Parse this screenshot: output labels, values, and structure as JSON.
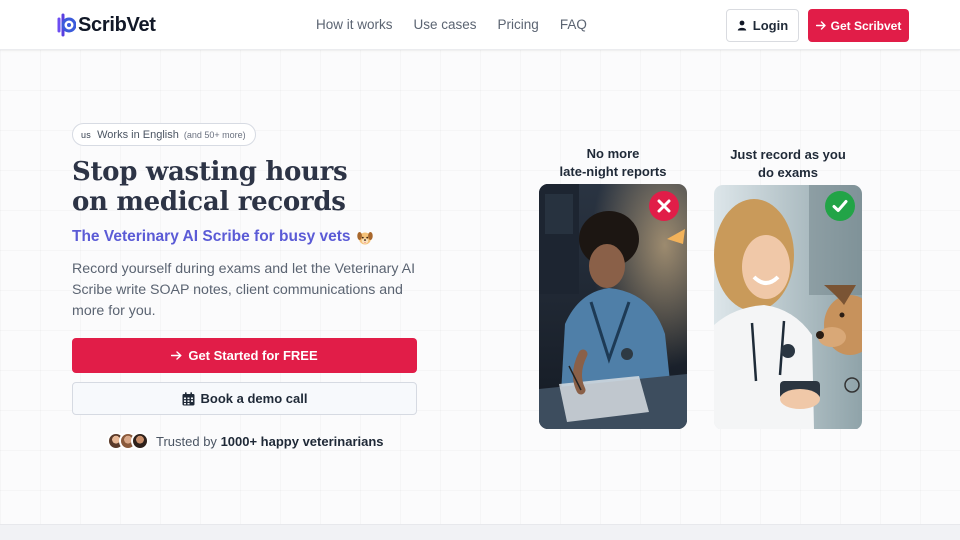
{
  "brand": {
    "name": "ScribVet"
  },
  "nav": {
    "links": [
      "How it works",
      "Use cases",
      "Pricing",
      "FAQ"
    ],
    "login_label": "Login",
    "get_label": "Get Scribvet"
  },
  "hero": {
    "lang_flag": "us",
    "lang_text": "Works in English",
    "lang_sub": "(and 50+ more)",
    "headline_line1": "Stop wasting hours",
    "headline_line2": "on medical records",
    "subheadline": "The Veterinary AI Scribe for busy vets",
    "description": "Record yourself during exams and let the Veterinary AI Scribe write SOAP notes, client communications and more for you.",
    "cta_primary": "Get Started for FREE",
    "cta_secondary": "Book a demo call",
    "trust_prefix": "Trusted by",
    "trust_bold": "1000+ happy veterinarians"
  },
  "comparison": {
    "left": {
      "caption_line1": "No more",
      "caption_line2": "late-night reports"
    },
    "right": {
      "caption_line1": "Just record as you",
      "caption_line2": "do exams"
    }
  },
  "colors": {
    "accent": "#e11d48",
    "subhead": "#5b5bd6",
    "headline": "#2d3446",
    "bad": "#e11d48",
    "good": "#22a447"
  }
}
